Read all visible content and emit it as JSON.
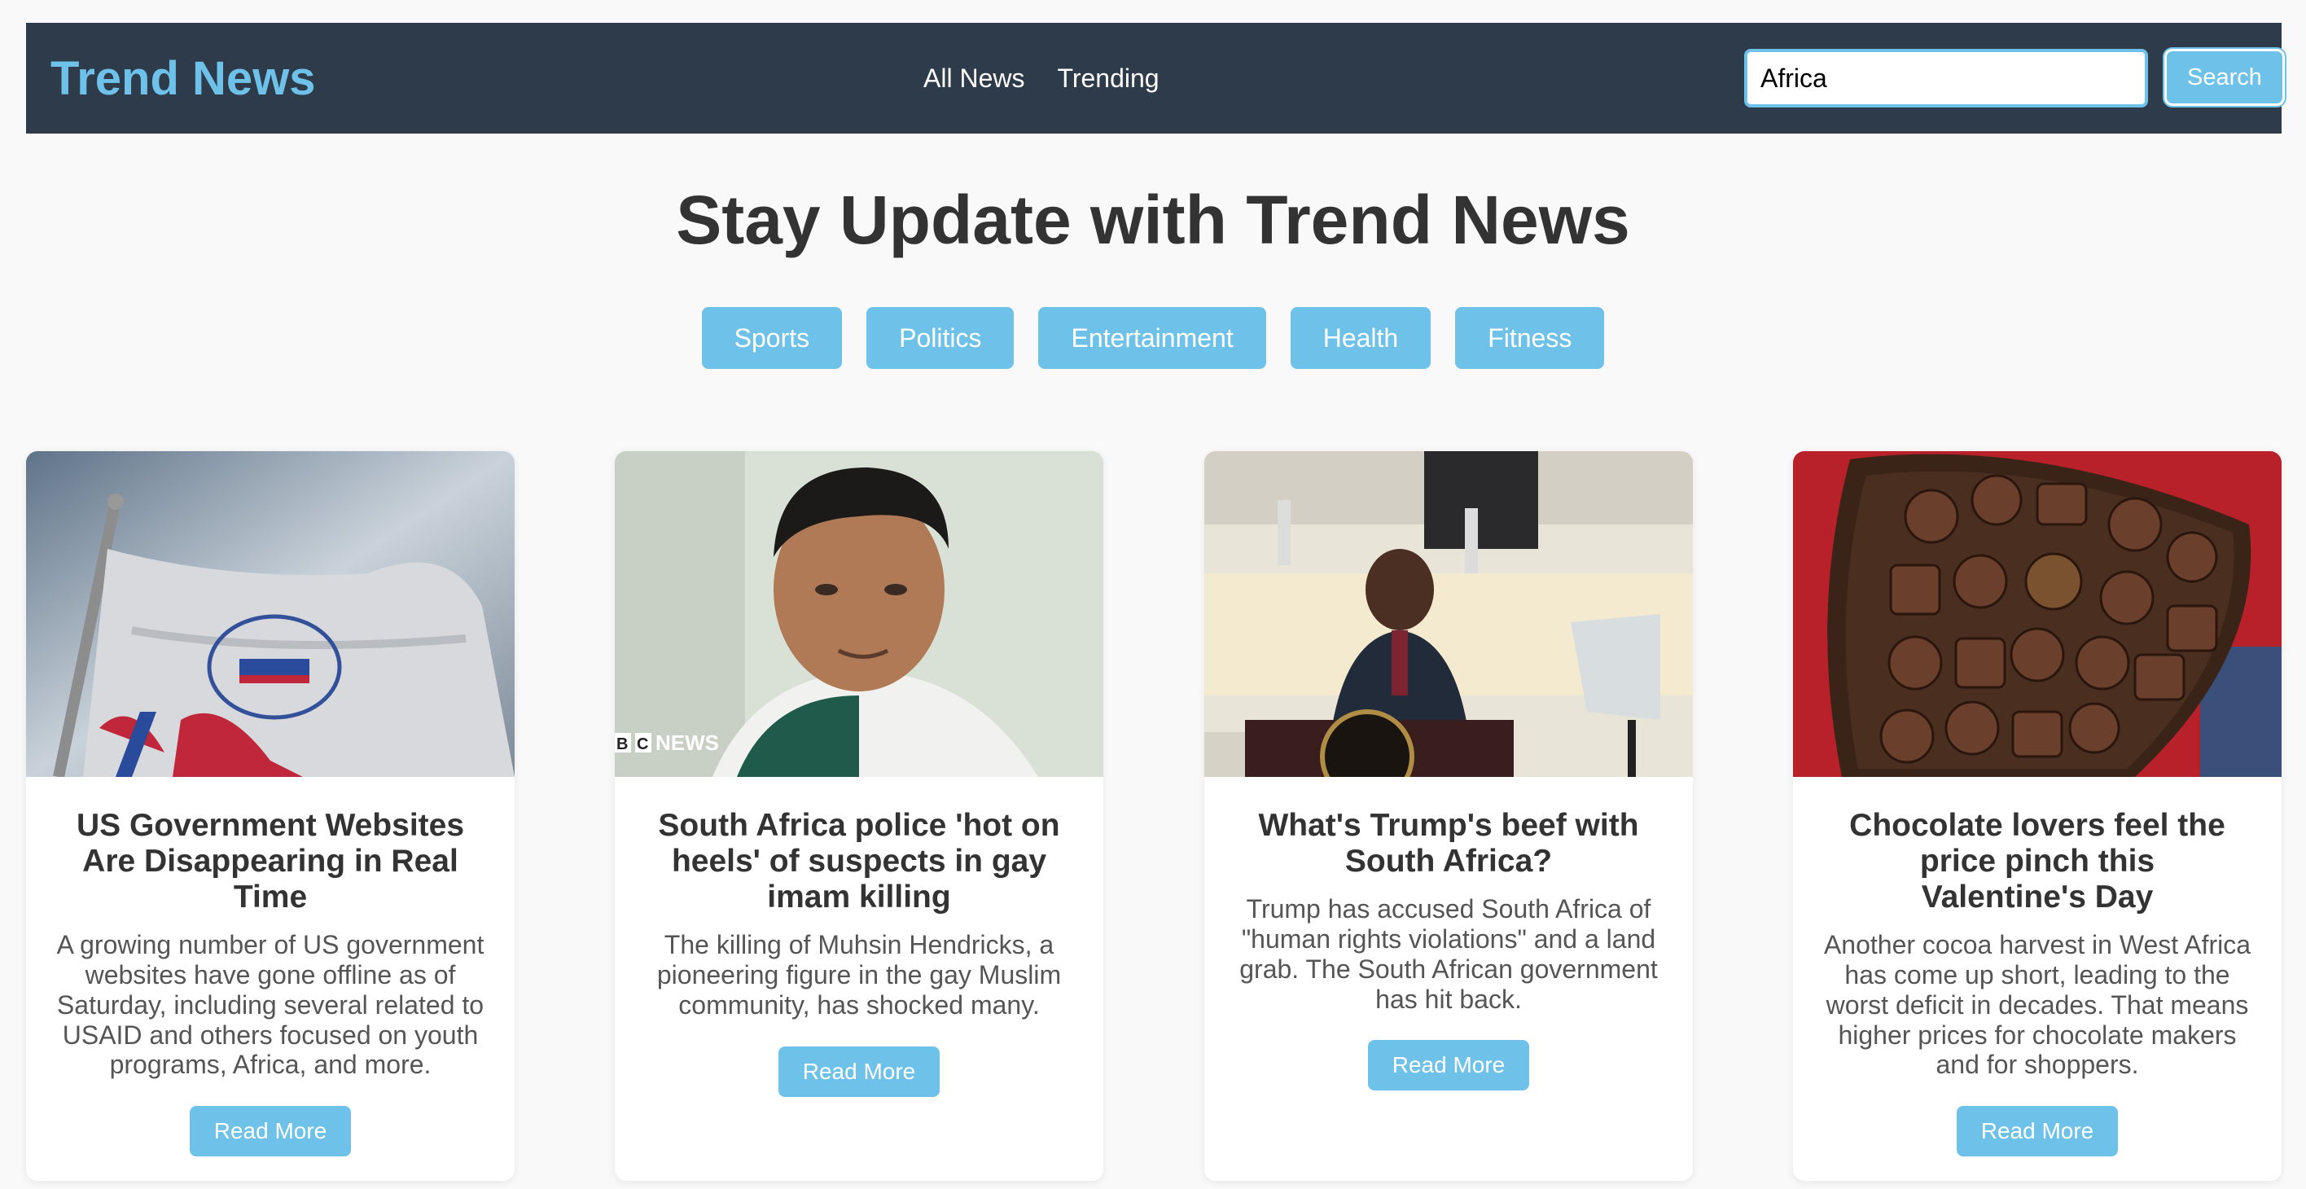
{
  "navbar": {
    "brand": "Trend News",
    "links": [
      "All News",
      "Trending"
    ],
    "search_value": "Africa",
    "search_button": "Search"
  },
  "hero": {
    "title": "Stay Update with Trend News"
  },
  "categories": [
    "Sports",
    "Politics",
    "Entertainment",
    "Health",
    "Fitness"
  ],
  "articles": [
    {
      "title": "US Government Websites Are Disappearing in Real Time",
      "description": "A growing number of US government websites have gone offline as of Saturday, including several related to USAID and others focused on youth programs, Africa, and more.",
      "button": "Read More",
      "image": "usaid-flag-photo"
    },
    {
      "title": "South Africa police 'hot on heels' of suspects in gay imam killing",
      "description": "The killing of Muhsin Hendricks, a pioneering figure in the gay Muslim community, has shocked many.",
      "button": "Read More",
      "image": "man-portrait-photo",
      "image_watermark": "BBC NEWS"
    },
    {
      "title": "What's Trump's beef with South Africa?",
      "description": "Trump has accused South Africa of \"human rights violations\" and a land grab. The South African government has hit back.",
      "button": "Read More",
      "image": "speaker-podium-photo"
    },
    {
      "title": "Chocolate lovers feel the price pinch this Valentine's Day",
      "description": "Another cocoa harvest in West Africa has come up short, leading to the worst deficit in decades. That means higher prices for chocolate makers and for shoppers.",
      "button": "Read More",
      "image": "chocolate-box-photo"
    }
  ],
  "colors": {
    "navbar_bg": "#2e3b4b",
    "accent": "#6ec2ea",
    "page_bg": "#f9f9f9"
  }
}
